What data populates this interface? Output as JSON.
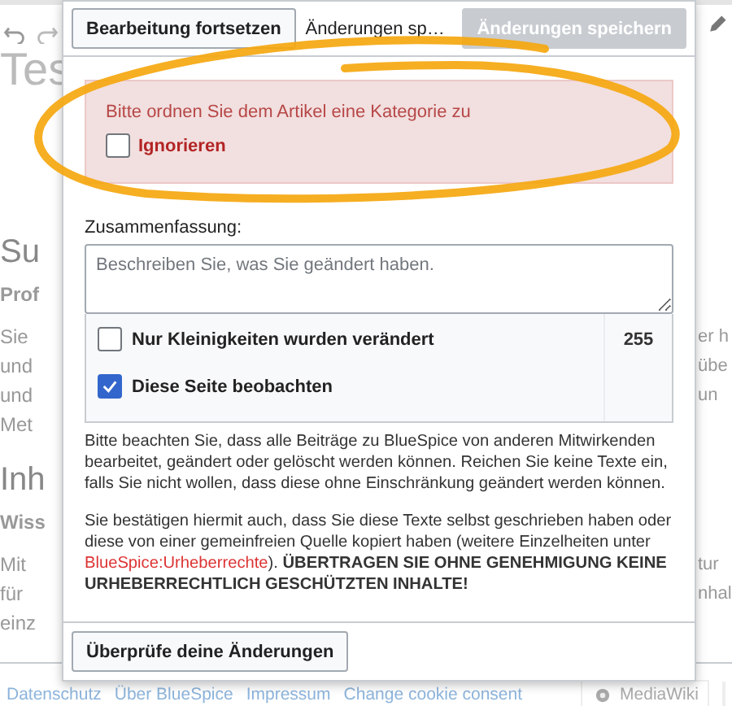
{
  "page": {
    "rows": [
      {
        "kind": "title",
        "left": "Tes"
      },
      {
        "kind": "heading",
        "left": "Su"
      },
      {
        "kind": "bold",
        "left": "Prof"
      },
      {
        "kind": "text",
        "left": "Sie",
        "right": "er h"
      },
      {
        "kind": "text",
        "left": "und",
        "right": "übe"
      },
      {
        "kind": "text",
        "left": "und",
        "right": "un"
      },
      {
        "kind": "text",
        "left": "Met"
      },
      {
        "kind": "heading",
        "left": "Inh"
      },
      {
        "kind": "bold",
        "left": "Wiss"
      },
      {
        "kind": "text",
        "left": "Mit",
        "right": "tur"
      },
      {
        "kind": "text",
        "left": "für",
        "right": "nhal"
      },
      {
        "kind": "text",
        "left": "einz"
      }
    ]
  },
  "footer": {
    "links": [
      "Datenschutz",
      "Über BlueSpice",
      "Impressum",
      "Change cookie consent"
    ],
    "badge": "MediaWiki"
  },
  "dialog": {
    "continue_button": "Bearbeitung fortsetzen",
    "title": "Änderungen sp…",
    "save_button": {
      "label": "Änderungen speichern",
      "disabled": true
    },
    "warning": {
      "message": "Bitte ordnen Sie dem Artikel eine Kategorie zu",
      "ignore": {
        "label": "Ignorieren",
        "checked": false
      }
    },
    "summary": {
      "label": "Zusammenfassung:",
      "placeholder": "Beschreiben Sie, was Sie geändert haben."
    },
    "options": [
      {
        "label": "Nur Kleinigkeiten wurden verändert",
        "checked": false
      },
      {
        "label": "Diese Seite beobachten",
        "checked": true
      }
    ],
    "char_count": "255",
    "notice": "Bitte beachten Sie, dass alle Beiträge zu BlueSpice von anderen Mitwirkenden bearbeitet, geändert oder gelöscht werden können. Reichen Sie keine Texte ein, falls Sie nicht wollen, dass diese ohne Einschränkung geändert werden können.",
    "license": {
      "before": "Sie bestätigen hiermit auch, dass Sie diese Texte selbst geschrieben haben oder diese von einer gemeinfreien Quelle kopiert haben (weitere Einzelheiten unter ",
      "link": "BlueSpice:Urheberrechte",
      "after": "). **ÜBERTRAGEN SIE OHNE GENEHMIGUNG KEINE URHEBERRECHTLICH GESCHÜTZTEN INHALTE!**"
    },
    "review_button": "Überprüfe deine Änderungen"
  }
}
